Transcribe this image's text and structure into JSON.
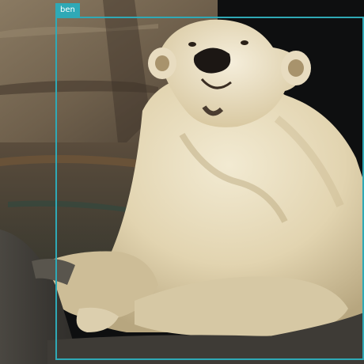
{
  "image": {
    "subject": "polar-bear",
    "detection": {
      "label": "ben",
      "box_color": "#2fa9b6"
    }
  }
}
